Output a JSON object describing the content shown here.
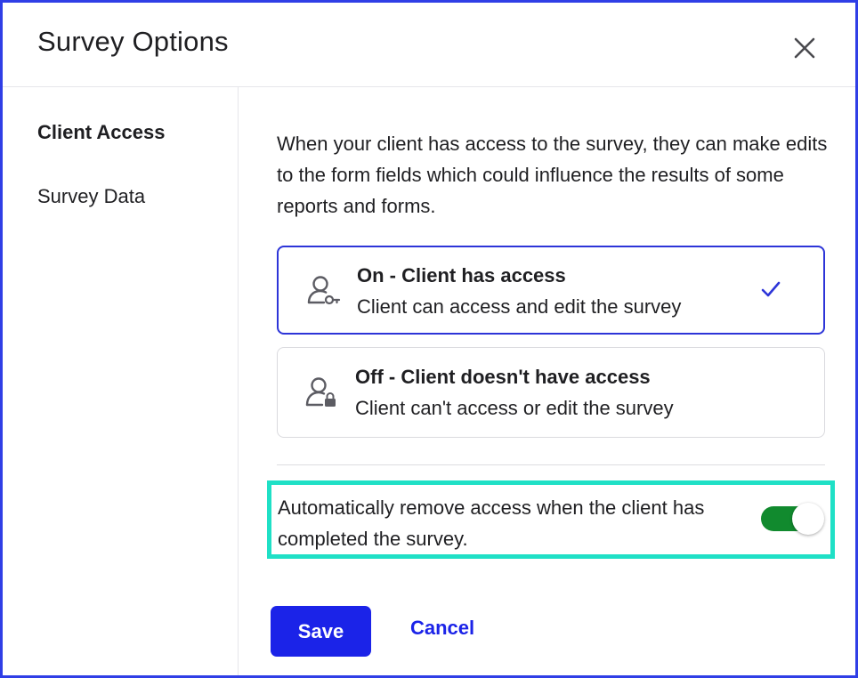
{
  "dialog": {
    "title": "Survey Options",
    "close_icon": "close-icon"
  },
  "sidebar": {
    "items": [
      {
        "label": "Client Access",
        "active": true
      },
      {
        "label": "Survey Data",
        "active": false
      }
    ]
  },
  "main": {
    "description": "When your client has access to the survey, they can make edits to the form fields which could influence the results of some reports and forms.",
    "options": [
      {
        "title": "On - Client has access",
        "subtitle": "Client can access and edit the survey",
        "icon": "user-key-icon",
        "selected": true
      },
      {
        "title": "Off - Client doesn't have access",
        "subtitle": "Client can't access or edit the survey",
        "icon": "user-lock-icon",
        "selected": false
      }
    ],
    "auto_remove": {
      "label": "Automatically remove access when the client has completed the survey.",
      "enabled": true
    }
  },
  "footer": {
    "save_label": "Save",
    "cancel_label": "Cancel"
  },
  "colors": {
    "accent": "#1b23e8",
    "selected_border": "#2d35d8",
    "toggle_on": "#118a2e",
    "highlight": "#1fe0c6"
  }
}
